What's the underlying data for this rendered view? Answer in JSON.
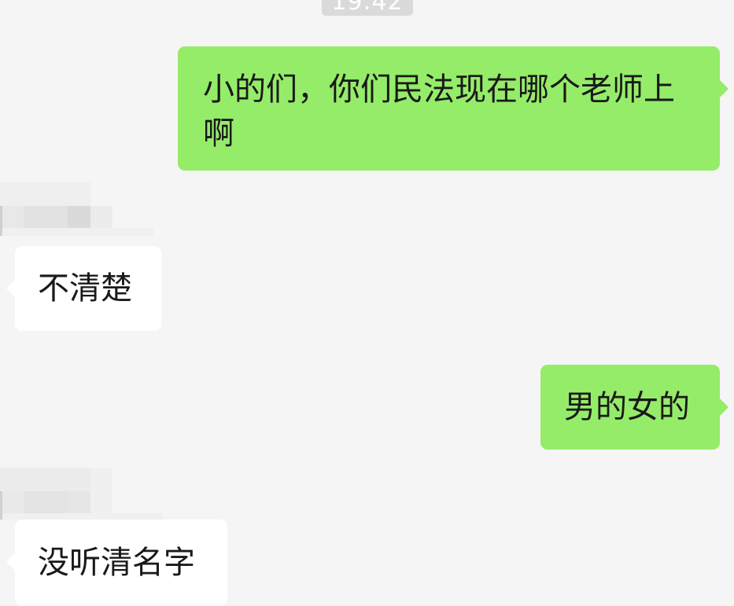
{
  "chat": {
    "timestamp": "19:42",
    "messages": [
      {
        "direction": "outgoing",
        "text": "小的们，你们民法现在哪个老师上啊"
      },
      {
        "direction": "incoming",
        "text": "不清楚"
      },
      {
        "direction": "outgoing",
        "text": "男的女的"
      },
      {
        "direction": "incoming",
        "text": "没听清名字"
      }
    ]
  },
  "colors": {
    "background": "#f5f5f5",
    "outgoing_bubble": "#95ec69",
    "incoming_bubble": "#ffffff",
    "timestamp_badge": "#dadada",
    "text": "#191919"
  }
}
